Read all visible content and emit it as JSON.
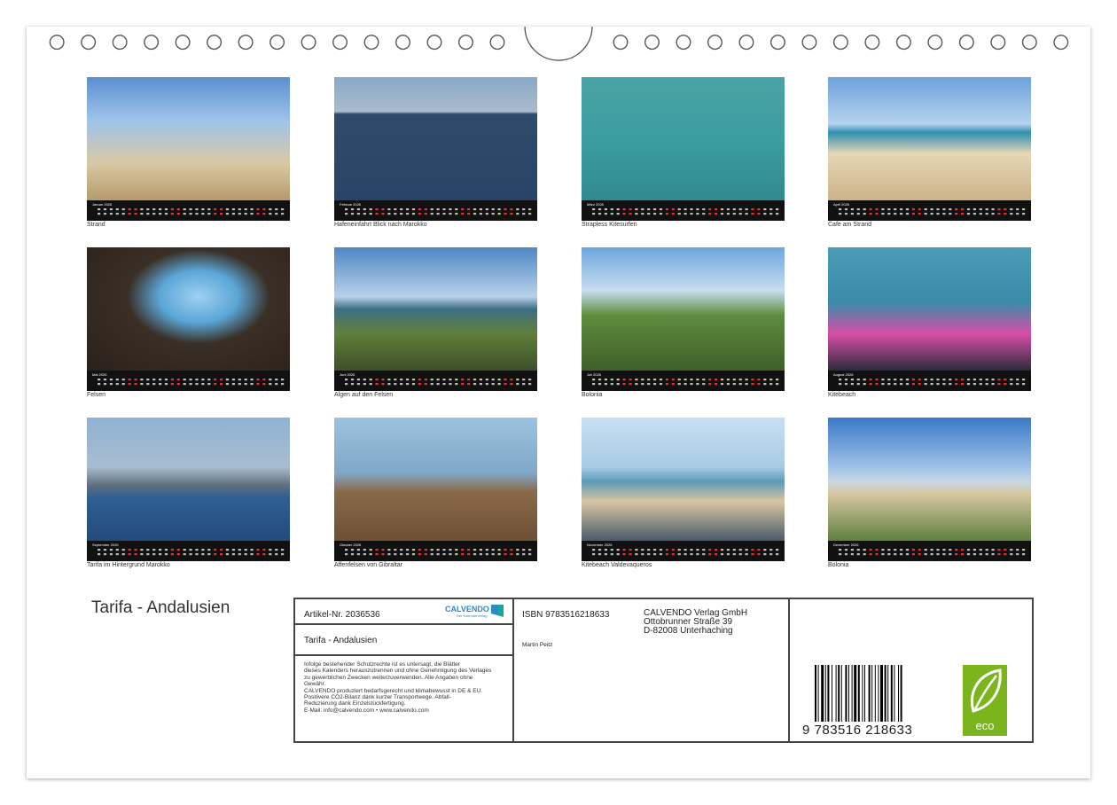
{
  "calendar": {
    "year": "2026",
    "months": [
      {
        "month": "Januar",
        "caption": "Strand"
      },
      {
        "month": "Februar",
        "caption": "Hafeneinfahrt Blick nach Marokko"
      },
      {
        "month": "März",
        "caption": "Strapless Kitesurfen"
      },
      {
        "month": "April",
        "caption": "Cafe am Strand"
      },
      {
        "month": "Mai",
        "caption": "Felsen"
      },
      {
        "month": "Juni",
        "caption": "Algen auf den Felsen"
      },
      {
        "month": "Juli",
        "caption": "Bolonia"
      },
      {
        "month": "August",
        "caption": "Kitebeach"
      },
      {
        "month": "September",
        "caption": "Tarifa im Hintergrund Marokko"
      },
      {
        "month": "Oktober",
        "caption": "Affenfelsen von Gibraltar"
      },
      {
        "month": "November",
        "caption": "Kitebeach Valdevaqueros"
      },
      {
        "month": "Dezember",
        "caption": "Bolonia"
      }
    ]
  },
  "title": "Tarifa - Andalusien",
  "info": {
    "article": "Artikel-Nr. 2036536",
    "brand": "CALVENDO",
    "brand_tagline": "Der Kalenderverlag",
    "product_title": "Tarifa - Andalusien",
    "legal": [
      "Infolge bestehender Schutzrechte ist es untersagt, die Blätter",
      "dieses Kalenders herauszutrennen und ohne Genehmigung des Verlages",
      "zu gewerblichen Zwecken weiterzuverwenden. Alle Angaben ohne",
      "Gewähr.",
      "CALVENDO produziert bedarfsgerecht und klimabewusst in DE & EU.",
      "Positivere CO2-Bilanz dank kurzer Transportwege. Abfall-",
      "Reduzierung dank Einzelstückfertigung.",
      "E-Mail: info@calvendo.com • www.calvendo.com"
    ],
    "isbn": "ISBN 9783516218633",
    "author": "Martin Peitz",
    "publisher": [
      "CALVENDO Verlag GmbH",
      "Ottobrunner Straße 39",
      "D-82008 Unterhaching"
    ],
    "barcode_digits": "9 783516 218633",
    "eco_label": "eco"
  },
  "colors": {
    "calbar": "#111111",
    "eco_green": "#7ab51d",
    "frame": "#444444"
  }
}
